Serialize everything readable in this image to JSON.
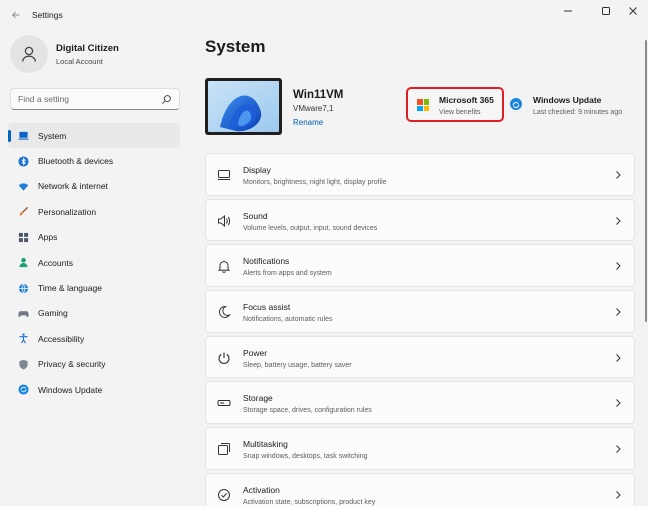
{
  "window": {
    "title": "Settings"
  },
  "profile": {
    "name": "Digital Citizen",
    "account": "Local Account"
  },
  "search": {
    "placeholder": "Find a setting"
  },
  "sidebar": {
    "items": [
      {
        "label": "System",
        "icon": "laptop-icon",
        "active": true
      },
      {
        "label": "Bluetooth & devices",
        "icon": "bluetooth-icon"
      },
      {
        "label": "Network & internet",
        "icon": "wifi-icon"
      },
      {
        "label": "Personalization",
        "icon": "brush-icon"
      },
      {
        "label": "Apps",
        "icon": "apps-icon"
      },
      {
        "label": "Accounts",
        "icon": "person-icon"
      },
      {
        "label": "Time & language",
        "icon": "globe-clock-icon"
      },
      {
        "label": "Gaming",
        "icon": "gamepad-icon"
      },
      {
        "label": "Accessibility",
        "icon": "accessibility-icon"
      },
      {
        "label": "Privacy & security",
        "icon": "shield-icon"
      },
      {
        "label": "Windows Update",
        "icon": "update-icon"
      }
    ]
  },
  "main": {
    "page_title": "System",
    "device": {
      "name": "Win11VM",
      "model": "VMware7,1",
      "rename_label": "Rename"
    },
    "microsoft365": {
      "title": "Microsoft 365",
      "subtitle": "View benefits",
      "highlight_color": "#e01f25"
    },
    "windows_update": {
      "title": "Windows Update",
      "subtitle": "Last checked: 9 minutes ago"
    },
    "cards": [
      {
        "title": "Display",
        "subtitle": "Monitors, brightness, night light, display profile",
        "icon": "display-icon"
      },
      {
        "title": "Sound",
        "subtitle": "Volume levels, output, input, sound devices",
        "icon": "speaker-icon"
      },
      {
        "title": "Notifications",
        "subtitle": "Alerts from apps and system",
        "icon": "bell-icon"
      },
      {
        "title": "Focus assist",
        "subtitle": "Notifications, automatic rules",
        "icon": "moon-icon"
      },
      {
        "title": "Power",
        "subtitle": "Sleep, battery usage, battery saver",
        "icon": "power-icon"
      },
      {
        "title": "Storage",
        "subtitle": "Storage space, drives, configuration rules",
        "icon": "storage-icon"
      },
      {
        "title": "Multitasking",
        "subtitle": "Snap windows, desktops, task switching",
        "icon": "multitasking-icon"
      },
      {
        "title": "Activation",
        "subtitle": "Activation state, subscriptions, product key",
        "icon": "activation-icon"
      }
    ]
  },
  "colors": {
    "accent": "#0067c0",
    "link": "#005fb8",
    "background": "#f3f3f3"
  }
}
